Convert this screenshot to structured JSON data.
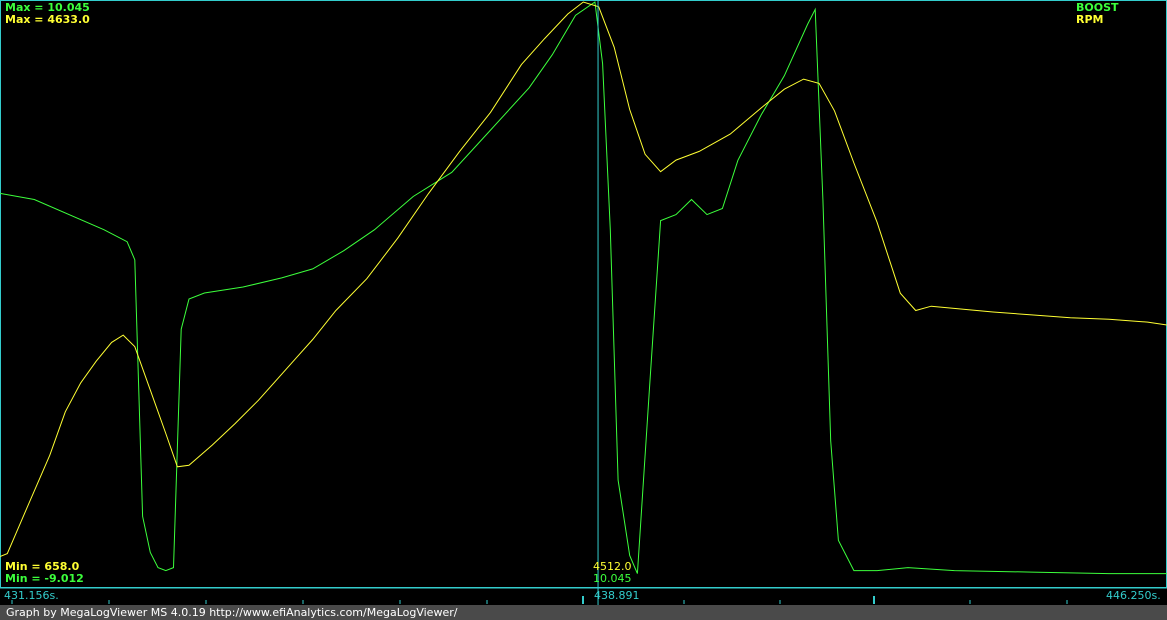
{
  "chart_data": {
    "type": "line",
    "x_start_label": "431.156s.",
    "x_end_label": "446.250s.",
    "x_range": [
      431.156,
      446.25
    ],
    "cursor": {
      "time_label": "438.891",
      "time": 438.891,
      "rpm_value": "4512.0",
      "boost_value": "10.045"
    },
    "legend": [
      "BOOST",
      "RPM"
    ],
    "series": [
      {
        "name": "BOOST",
        "color": "#3cff3c",
        "max_label": "Max = 10.045",
        "min_label": "Min = -9.012",
        "ylim": [
          -9.012,
          10.045
        ],
        "points": [
          [
            431.156,
            3.7
          ],
          [
            431.6,
            3.5
          ],
          [
            432.5,
            2.5
          ],
          [
            432.8,
            2.1
          ],
          [
            432.9,
            1.5
          ],
          [
            433.0,
            -7.0
          ],
          [
            433.1,
            -8.2
          ],
          [
            433.2,
            -8.7
          ],
          [
            433.3,
            -8.8
          ],
          [
            433.4,
            -8.7
          ],
          [
            433.5,
            -0.8
          ],
          [
            433.6,
            0.2
          ],
          [
            433.8,
            0.4
          ],
          [
            434.3,
            0.6
          ],
          [
            434.8,
            0.9
          ],
          [
            435.2,
            1.2
          ],
          [
            435.6,
            1.8
          ],
          [
            436.0,
            2.5
          ],
          [
            436.5,
            3.6
          ],
          [
            437.0,
            4.4
          ],
          [
            437.5,
            5.8
          ],
          [
            438.0,
            7.2
          ],
          [
            438.3,
            8.3
          ],
          [
            438.6,
            9.6
          ],
          [
            438.85,
            10.045
          ],
          [
            438.95,
            8.0
          ],
          [
            439.05,
            2.5
          ],
          [
            439.15,
            -5.8
          ],
          [
            439.3,
            -8.3
          ],
          [
            439.4,
            -8.9
          ],
          [
            439.55,
            -3.0
          ],
          [
            439.7,
            2.8
          ],
          [
            439.9,
            3.0
          ],
          [
            440.1,
            3.5
          ],
          [
            440.3,
            3.0
          ],
          [
            440.5,
            3.2
          ],
          [
            440.7,
            4.8
          ],
          [
            441.0,
            6.3
          ],
          [
            441.3,
            7.6
          ],
          [
            441.6,
            9.3
          ],
          [
            441.7,
            9.8
          ],
          [
            441.8,
            3.5
          ],
          [
            441.9,
            -4.5
          ],
          [
            442.0,
            -7.8
          ],
          [
            442.2,
            -8.8
          ],
          [
            442.5,
            -8.8
          ],
          [
            442.9,
            -8.7
          ],
          [
            443.5,
            -8.8
          ],
          [
            444.5,
            -8.85
          ],
          [
            445.5,
            -8.9
          ],
          [
            446.25,
            -8.9
          ]
        ]
      },
      {
        "name": "RPM",
        "color": "#ffff33",
        "max_label": "Max = 4633.0",
        "min_label": "Min = 658.0",
        "ylim": [
          658.0,
          4633.0
        ],
        "points": [
          [
            431.156,
            800
          ],
          [
            431.25,
            820
          ],
          [
            431.5,
            1130
          ],
          [
            431.8,
            1500
          ],
          [
            432.0,
            1800
          ],
          [
            432.2,
            2000
          ],
          [
            432.4,
            2150
          ],
          [
            432.6,
            2280
          ],
          [
            432.75,
            2330
          ],
          [
            432.9,
            2250
          ],
          [
            433.1,
            1950
          ],
          [
            433.3,
            1650
          ],
          [
            433.45,
            1420
          ],
          [
            433.6,
            1430
          ],
          [
            433.9,
            1570
          ],
          [
            434.2,
            1720
          ],
          [
            434.5,
            1880
          ],
          [
            434.8,
            2060
          ],
          [
            435.0,
            2180
          ],
          [
            435.2,
            2300
          ],
          [
            435.5,
            2500
          ],
          [
            435.9,
            2720
          ],
          [
            436.3,
            3000
          ],
          [
            436.7,
            3310
          ],
          [
            437.1,
            3600
          ],
          [
            437.5,
            3870
          ],
          [
            437.9,
            4200
          ],
          [
            438.2,
            4380
          ],
          [
            438.5,
            4550
          ],
          [
            438.7,
            4633
          ],
          [
            438.9,
            4600
          ],
          [
            439.1,
            4320
          ],
          [
            439.3,
            3890
          ],
          [
            439.5,
            3580
          ],
          [
            439.7,
            3460
          ],
          [
            439.9,
            3540
          ],
          [
            440.2,
            3600
          ],
          [
            440.6,
            3720
          ],
          [
            441.0,
            3900
          ],
          [
            441.3,
            4030
          ],
          [
            441.55,
            4100
          ],
          [
            441.75,
            4070
          ],
          [
            441.95,
            3880
          ],
          [
            442.2,
            3520
          ],
          [
            442.5,
            3110
          ],
          [
            442.8,
            2620
          ],
          [
            443.0,
            2500
          ],
          [
            443.2,
            2530
          ],
          [
            443.6,
            2510
          ],
          [
            444.0,
            2490
          ],
          [
            444.5,
            2470
          ],
          [
            445.0,
            2450
          ],
          [
            445.5,
            2440
          ],
          [
            446.0,
            2420
          ],
          [
            446.25,
            2400
          ]
        ]
      }
    ]
  },
  "footer_text": "Graph by MegaLogViewer MS 4.0.19 http://www.efiAnalytics.com/MegaLogViewer/"
}
